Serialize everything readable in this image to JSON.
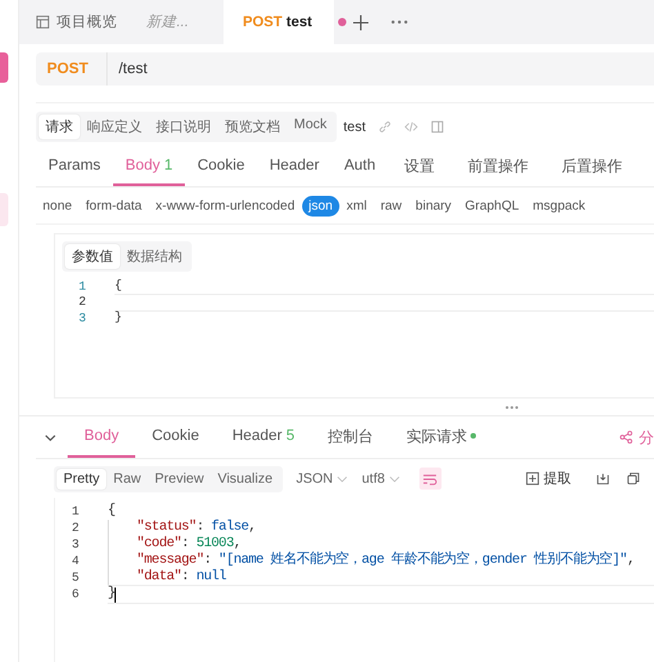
{
  "tabs": [
    {
      "kind": "page",
      "label": "项目概览",
      "selected": false
    },
    {
      "kind": "draft",
      "label": "新建...",
      "selected": false
    },
    {
      "kind": "request",
      "method": "POST",
      "label": "test",
      "unsaved": true,
      "selected": true
    }
  ],
  "request": {
    "method": "POST",
    "url": "/test"
  },
  "doc_tabs": [
    {
      "label": "请求",
      "selected": true
    },
    {
      "label": "响应定义",
      "selected": false
    },
    {
      "label": "接口说明",
      "selected": false
    },
    {
      "label": "预览文档",
      "selected": false
    },
    {
      "label": "Mock",
      "selected": false
    }
  ],
  "api_name": "test",
  "param_tabs": [
    {
      "label": "Params",
      "selected": false
    },
    {
      "label": "Body",
      "count": "1",
      "selected": true
    },
    {
      "label": "Cookie",
      "selected": false
    },
    {
      "label": "Header",
      "selected": false
    },
    {
      "label": "Auth",
      "selected": false
    },
    {
      "label": "设置",
      "selected": false
    },
    {
      "label": "前置操作",
      "selected": false
    },
    {
      "label": "后置操作",
      "selected": false
    }
  ],
  "body_types": [
    {
      "label": "none",
      "selected": false
    },
    {
      "label": "form-data",
      "selected": false
    },
    {
      "label": "x-www-form-urlencoded",
      "selected": false
    },
    {
      "label": "json",
      "selected": true
    },
    {
      "label": "xml",
      "selected": false
    },
    {
      "label": "raw",
      "selected": false
    },
    {
      "label": "binary",
      "selected": false
    },
    {
      "label": "GraphQL",
      "selected": false
    },
    {
      "label": "msgpack",
      "selected": false
    }
  ],
  "body_view_tabs": [
    {
      "label": "参数值",
      "selected": true
    },
    {
      "label": "数据结构",
      "selected": false
    }
  ],
  "body_editor": {
    "lines": [
      {
        "number": "1",
        "text": "{",
        "current": false
      },
      {
        "number": "2",
        "current": true
      },
      {
        "number": "3",
        "text": "}",
        "current": false
      }
    ]
  },
  "response": {
    "tabs": [
      {
        "label": "Body",
        "selected": true
      },
      {
        "label": "Cookie",
        "selected": false
      },
      {
        "label": "Header",
        "count": "5",
        "selected": false
      },
      {
        "label": "控制台",
        "selected": false
      },
      {
        "label": "实际请求",
        "dot": true,
        "selected": false
      }
    ],
    "share_label": "分",
    "view_modes": [
      {
        "label": "Pretty",
        "selected": true
      },
      {
        "label": "Raw",
        "selected": false
      },
      {
        "label": "Preview",
        "selected": false
      },
      {
        "label": "Visualize",
        "selected": false
      }
    ],
    "format": "JSON",
    "encoding": "utf8",
    "wrap_on": true,
    "extract_label": "提取",
    "code_lines": [
      {
        "number": "1",
        "indented": false,
        "current": false,
        "tokens": [
          {
            "kind": "punct",
            "text": "{"
          }
        ]
      },
      {
        "number": "2",
        "indented": true,
        "current": false,
        "tokens": [
          {
            "kind": "key",
            "text": "\"status\""
          },
          {
            "kind": "punct",
            "text": ": "
          },
          {
            "kind": "literal",
            "text": "false"
          },
          {
            "kind": "punct",
            "text": ","
          }
        ]
      },
      {
        "number": "3",
        "indented": true,
        "current": false,
        "tokens": [
          {
            "kind": "key",
            "text": "\"code\""
          },
          {
            "kind": "punct",
            "text": ": "
          },
          {
            "kind": "number",
            "text": "51003"
          },
          {
            "kind": "punct",
            "text": ","
          }
        ]
      },
      {
        "number": "4",
        "indented": true,
        "current": false,
        "tokens": [
          {
            "kind": "key",
            "text": "\"message\""
          },
          {
            "kind": "punct",
            "text": ": "
          },
          {
            "kind": "string",
            "text": "\"[name 姓名不能为空，age 年龄不能为空，gender 性别不能为空]\""
          },
          {
            "kind": "punct",
            "text": ","
          }
        ]
      },
      {
        "number": "5",
        "indented": true,
        "current": false,
        "tokens": [
          {
            "kind": "key",
            "text": "\"data\""
          },
          {
            "kind": "punct",
            "text": ": "
          },
          {
            "kind": "literal",
            "text": "null"
          }
        ]
      },
      {
        "number": "6",
        "indented": false,
        "current": true,
        "tokens": [
          {
            "kind": "punct",
            "text": "}"
          }
        ]
      }
    ]
  }
}
